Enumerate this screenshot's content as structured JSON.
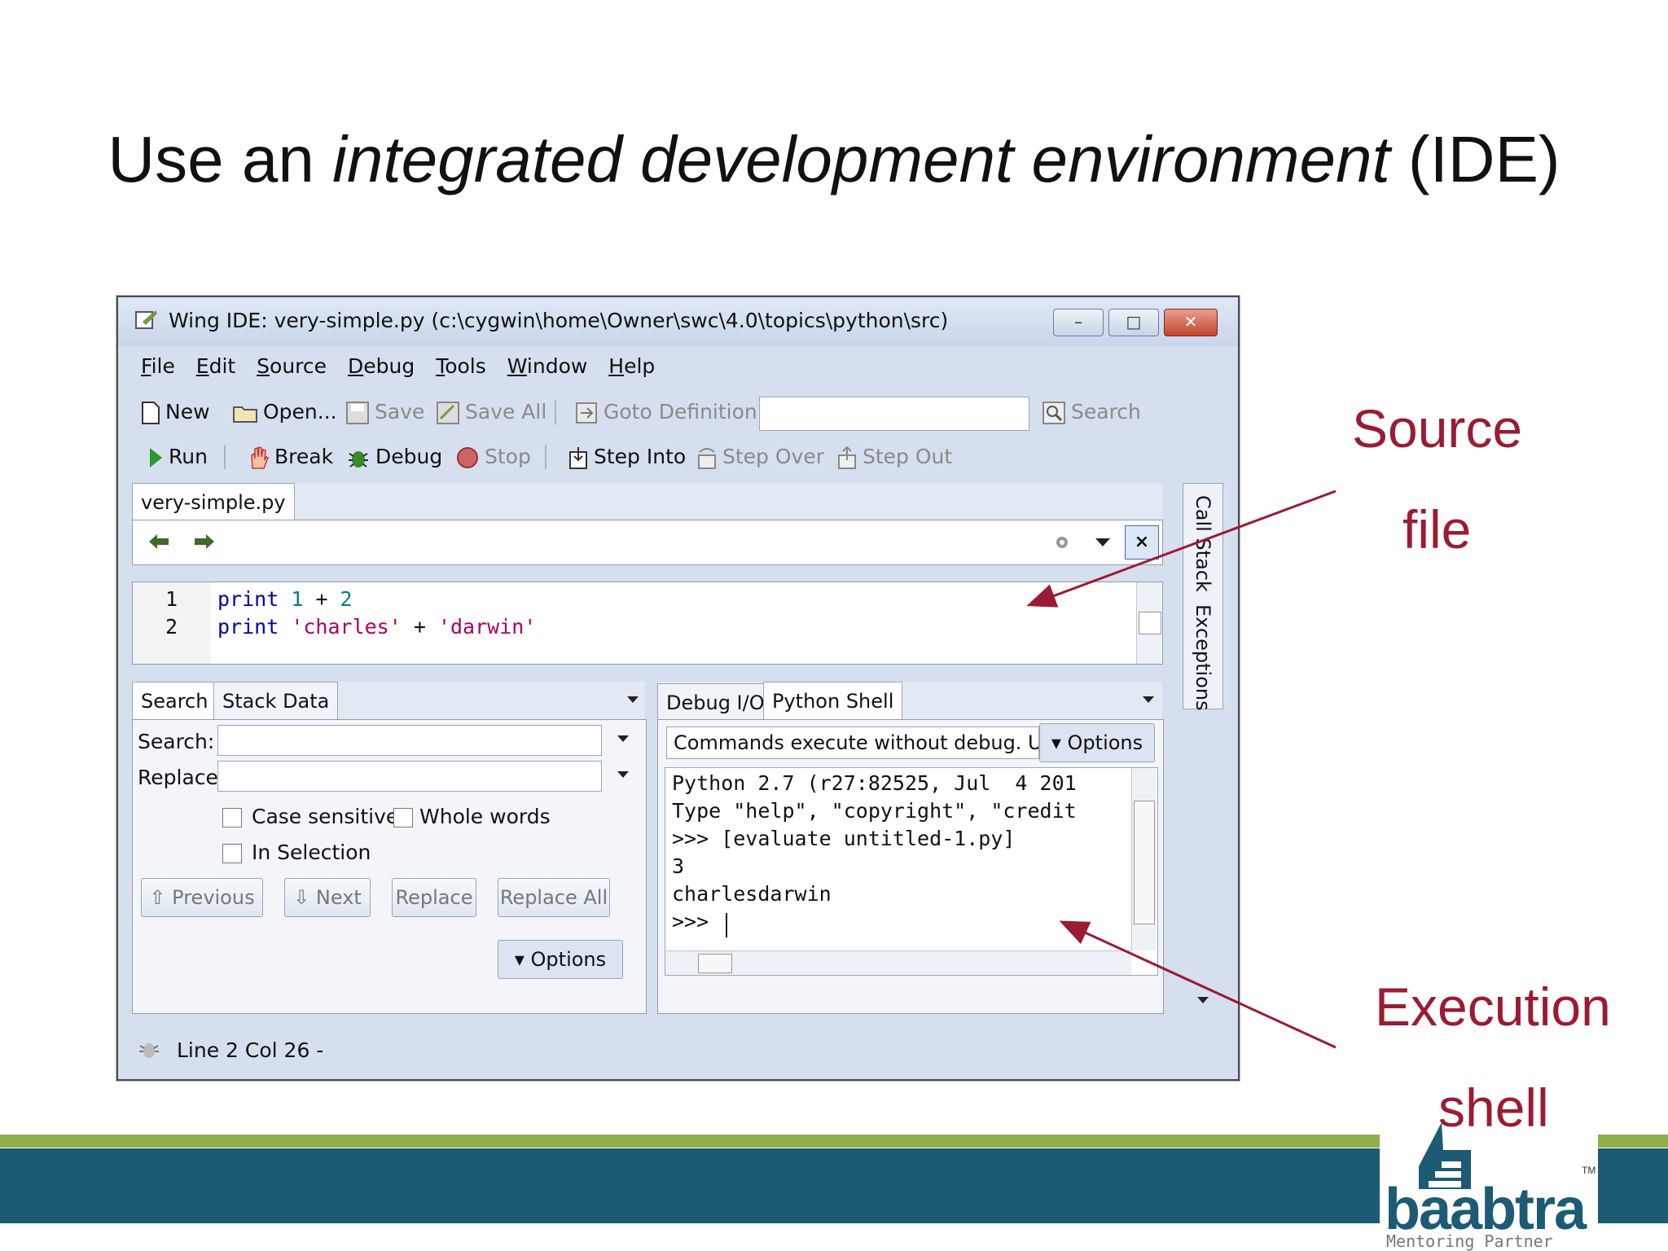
{
  "slide": {
    "title_prefix": "Use an ",
    "title_italic": "integrated development environment",
    "title_suffix": " (IDE)"
  },
  "callouts": {
    "source_line1": "Source",
    "source_line2": "file",
    "exec_line1": "Execution",
    "exec_line2": "shell"
  },
  "window": {
    "title": "Wing IDE: very-simple.py (c:\\cygwin\\home\\Owner\\swc\\4.0\\topics\\python\\src)",
    "controls": {
      "minimize": "–",
      "maximize": "□",
      "close": "✕"
    }
  },
  "menu": [
    {
      "first": "F",
      "rest": "ile"
    },
    {
      "first": "E",
      "rest": "dit"
    },
    {
      "first": "S",
      "rest": "ource"
    },
    {
      "first": "D",
      "rest": "ebug"
    },
    {
      "first": "T",
      "rest": "ools"
    },
    {
      "first": "W",
      "rest": "indow"
    },
    {
      "first": "H",
      "rest": "elp"
    }
  ],
  "toolbar1": {
    "new": "New",
    "open": "Open...",
    "save": "Save",
    "save_all": "Save All",
    "goto": "Goto Definition",
    "search": "Search"
  },
  "toolbar2": {
    "run": "Run",
    "break": "Break",
    "debug": "Debug",
    "stop": "Stop",
    "step_into": "Step Into",
    "step_over": "Step Over",
    "step_out": "Step Out"
  },
  "editor": {
    "tab": "very-simple.py",
    "lines": [
      {
        "num": "1",
        "kw": "print",
        "rest": " ",
        "a": "1",
        "op": " + ",
        "b": "2"
      },
      {
        "num": "2",
        "kw": "print",
        "rest": " ",
        "a": "'charles'",
        "op": " + ",
        "b": "'darwin'"
      }
    ]
  },
  "side_tabs": {
    "call_stack": "Call Stack",
    "exceptions": "Exceptions"
  },
  "search_panel": {
    "tabs": [
      "Search",
      "Stack Data"
    ],
    "search_label": "Search:",
    "replace_label": "Replace:",
    "case_sensitive": "Case sensitive",
    "whole_words": "Whole words",
    "in_selection": "In Selection",
    "previous": "Previous",
    "next": "Next",
    "replace": "Replace",
    "replace_all": "Replace All",
    "options": "Options"
  },
  "shell_panel": {
    "tabs": [
      "Debug I/O",
      "Python Shell"
    ],
    "info": "Commands execute without debug.  U:",
    "options": "Options",
    "lines": [
      "Python 2.7 (r27:82525, Jul  4 201",
      "Type \"help\", \"copyright\", \"credit",
      ">>> [evaluate untitled-1.py]",
      "3",
      "charlesdarwin",
      ">>> "
    ]
  },
  "status": {
    "text": "Line 2 Col 26 -"
  },
  "logo": {
    "name": "baabtra",
    "tagline": "Mentoring Partner",
    "tm": "TM"
  },
  "colors": {
    "callout": "#9b1b33",
    "footer_blue": "#1c5b73",
    "footer_green": "#8fae4c"
  }
}
